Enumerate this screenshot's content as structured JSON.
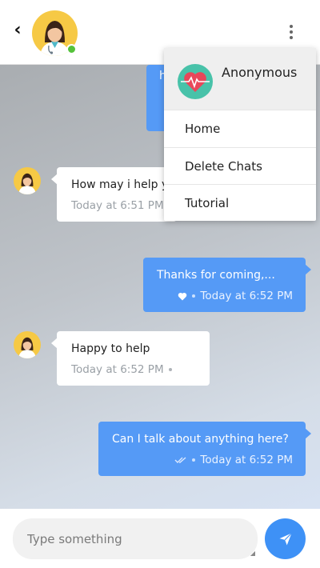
{
  "header": {
    "back_icon": "chevron-left-icon",
    "avatar_icon": "doctor-avatar",
    "status": "online",
    "more_icon": "more-vertical-icon"
  },
  "menu": {
    "header_icon": "heartbeat-icon",
    "header_name": "Anonymous",
    "items": [
      "Home",
      "Delete Chats",
      "Tutorial"
    ]
  },
  "messages": [
    {
      "direction": "incoming",
      "text": "How may i help y",
      "time": "Today at 6:51 PM"
    },
    {
      "direction": "outgoing",
      "text": "Thanks for coming,...",
      "time": "Today at 6:52 PM",
      "reaction_icon": "heart-icon"
    },
    {
      "direction": "incoming",
      "text": "Happy to help",
      "time": "Today at 6:52 PM"
    },
    {
      "direction": "outgoing",
      "text": "Can I talk about anything here?",
      "time": "Today at 6:52 PM",
      "status_icon": "double-check-icon"
    }
  ],
  "composer": {
    "placeholder": "Type something",
    "send_icon": "send-icon"
  },
  "colors": {
    "accent_blue": "#559af6",
    "send_blue": "#3e91f6",
    "online_green": "#54c23a",
    "avatar_yellow": "#f6c945",
    "menu_icon_teal": "#48c2a9",
    "top_accent_red": "#d33a2c"
  }
}
